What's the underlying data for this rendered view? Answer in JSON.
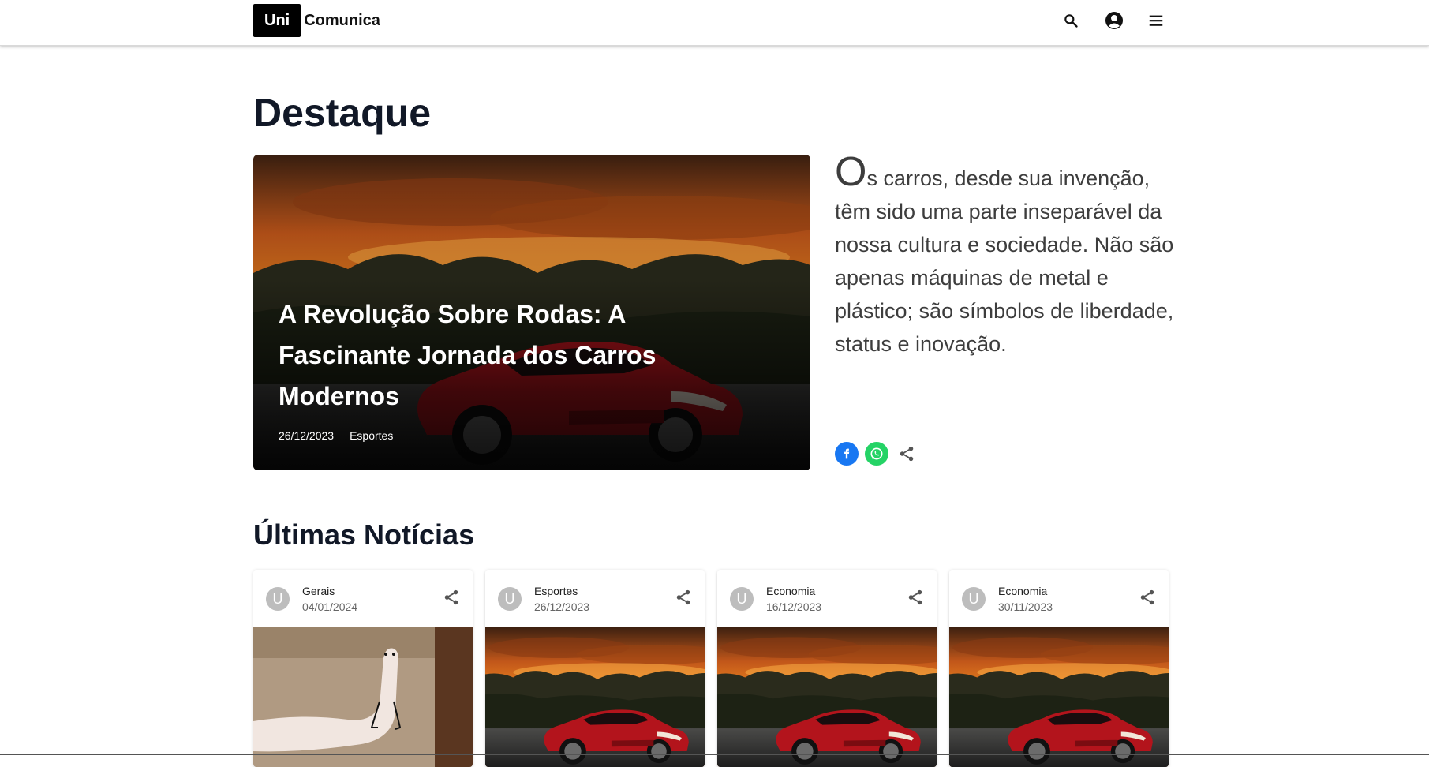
{
  "header": {
    "logo_box": "Uni",
    "logo_text": "Comunica",
    "icons": [
      "search-icon",
      "account-circle-icon",
      "menu-icon"
    ]
  },
  "featured": {
    "heading": "Destaque",
    "title": "A Revolução Sobre Rodas: A Fascinante Jornada dos Carros Modernos",
    "date": "26/12/2023",
    "category": "Esportes",
    "lead_dropcap": "O",
    "lead_rest": "s carros, desde sua invenção, têm sido uma parte inseparável da nossa cultura e sociedade. Não são apenas máquinas de metal e plástico; são símbolos de liberdade, status e inovação.",
    "share": [
      "facebook-icon",
      "whatsapp-icon",
      "share-icon"
    ]
  },
  "latest": {
    "heading": "Últimas Notícias",
    "cards": [
      {
        "avatar": "U",
        "category": "Gerais",
        "date": "04/01/2024",
        "image": "snake-toy-photo"
      },
      {
        "avatar": "U",
        "category": "Esportes",
        "date": "26/12/2023",
        "image": "red-car-sunset-photo"
      },
      {
        "avatar": "U",
        "category": "Economia",
        "date": "16/12/2023",
        "image": "red-car-sunset-photo"
      },
      {
        "avatar": "U",
        "category": "Economia",
        "date": "30/11/2023",
        "image": "red-car-sunset-photo"
      }
    ]
  },
  "colors": {
    "facebook": "#1877F2",
    "whatsapp": "#25D366",
    "heading": "#111827",
    "avatar": "#bdbdbd"
  }
}
